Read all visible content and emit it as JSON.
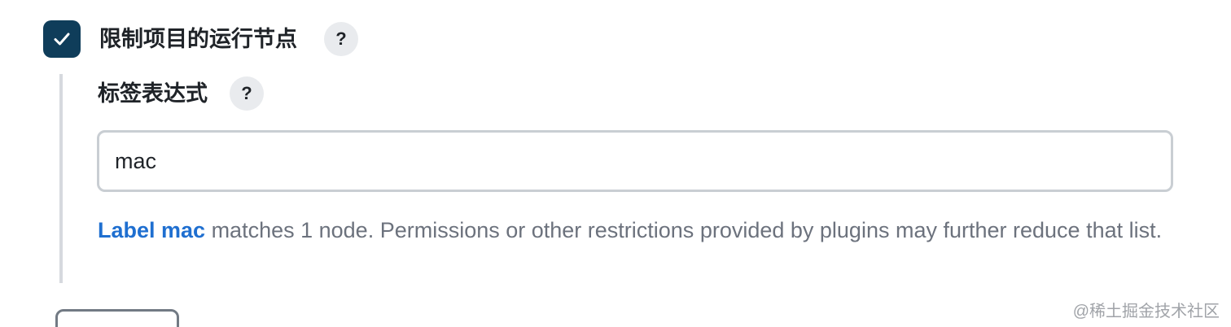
{
  "restrict": {
    "checked": true,
    "label": "限制项目的运行节点",
    "help": "?"
  },
  "label_expression": {
    "label": "标签表达式",
    "help": "?",
    "value": "mac"
  },
  "description": {
    "link_text": "Label mac",
    "text": " matches 1 node. Permissions or other restrictions provided by plugins may further reduce that list."
  },
  "watermark": "@稀土掘金技术社区",
  "colors": {
    "checkbox": "#0f3d5a",
    "link": "#1f6fd0",
    "muted_text": "#6c727d"
  }
}
